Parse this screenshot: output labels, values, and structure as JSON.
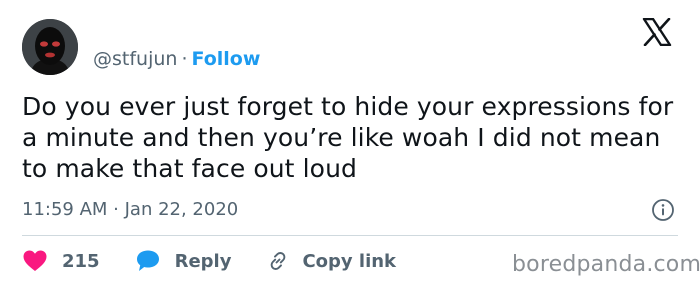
{
  "user": {
    "handle": "@stfujun",
    "separator": "·",
    "follow_label": "Follow"
  },
  "icons": {
    "logo": "x-logo-icon",
    "info": "info-icon",
    "like": "heart-icon",
    "reply": "speech-bubble-icon",
    "copy_link": "link-icon"
  },
  "tweet": {
    "text": "Do you ever just forget to hide your expressions for a minute and then you’re like woah I did not mean to make that face out loud",
    "timestamp": "11:59 AM · Jan 22, 2020"
  },
  "actions": {
    "like_count": "215",
    "reply_label": "Reply",
    "copy_label": "Copy link"
  },
  "watermark": "boredpanda.com",
  "colors": {
    "accent": "#1d9bf0",
    "like": "#f91880",
    "muted": "#536471",
    "text": "#0f1419"
  }
}
